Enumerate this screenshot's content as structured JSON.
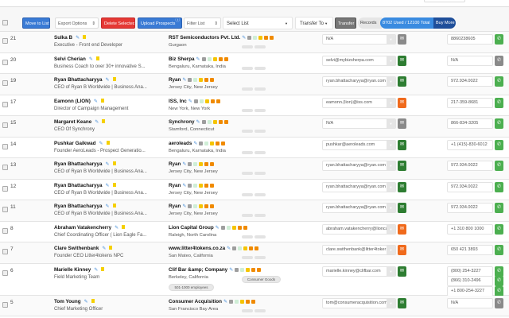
{
  "toolbar": {
    "move_to_list": "Move to List",
    "export_options": "Export Options",
    "delete_selected": "Delete Selected",
    "upload_prospects": "Upload Prospects",
    "filter_list": "Filter List",
    "select_list": "Select List",
    "transfer_to": "Transfer To",
    "transfer": "Transfer",
    "records": "Records",
    "usage": "8702 Used / 12100 Total",
    "buy_more": "Buy More"
  },
  "colors": {
    "green_email": "#2e7d32",
    "orange_email": "#f06a1c",
    "gray": "#8a8a8a",
    "green_phone": "#4caf50",
    "blue": "#3a7bd5",
    "red": "#e53935"
  },
  "rows": [
    {
      "num": "21",
      "name": "Sulka B",
      "title": "Executive - Front end Developer",
      "company": "RST Semiconductors Pvt. Ltd.",
      "location": "Gurgaon",
      "email": "N/A",
      "email_status": "gray",
      "phones": [
        "8860238605"
      ],
      "phone_status": "green"
    },
    {
      "num": "20",
      "name": "Selvi Cherian",
      "title": "Business Coach to over 30+ innovative S...",
      "company": "Biz Sherpa",
      "location": "Bengaluru, Karnataka, India",
      "email": "selvi@mybizsherpa.com",
      "email_status": "green",
      "phones": [
        "N/A"
      ],
      "phone_status": "gray"
    },
    {
      "num": "19",
      "name": "Ryan Bhattacharyya",
      "title": "CEO of Ryan B Worldwide | Business Ana...",
      "company": "Ryan",
      "location": "Jersey City, New Jersey",
      "email": "ryan.bhattacharyya@ryan.com",
      "email_status": "green",
      "phones": [
        "972.934.0022"
      ],
      "phone_status": "green"
    },
    {
      "num": "17",
      "name": "Eamonn (LION)",
      "title": "Director of Campaign Management",
      "company": "ISS, Inc",
      "location": "New York, New York",
      "email": "eamonn.(lion)@iss.com",
      "email_status": "orange",
      "phones": [
        "217-359-8681"
      ],
      "phone_status": "green"
    },
    {
      "num": "15",
      "name": "Margaret Keane",
      "title": "CEO Of Synchrony",
      "company": "Synchrony",
      "location": "Stamford, Connecticut",
      "email": "N/A",
      "email_status": "gray",
      "phones": [
        "866-834-3205"
      ],
      "phone_status": "green"
    },
    {
      "num": "14",
      "name": "Pushkar Gaikwad",
      "title": "Founder AeroLeads - Prospect Generatio...",
      "company": "aeroleads",
      "location": "Bengaluru, Karnataka, India",
      "email": "pushkar@aeroleads.com",
      "email_status": "green",
      "phones": [
        "+1 (415)-830-6012"
      ],
      "phone_status": "green"
    },
    {
      "num": "13",
      "name": "Ryan Bhattacharyya",
      "title": "CEO of Ryan B Worldwide | Business Ana...",
      "company": "Ryan",
      "location": "Jersey City, New Jersey",
      "email": "ryan.bhattacharyya@ryan.com",
      "email_status": "green",
      "phones": [
        "972.934.0022"
      ],
      "phone_status": "green"
    },
    {
      "num": "12",
      "name": "Ryan Bhattacharyya",
      "title": "CEO of Ryan B Worldwide | Business Ana...",
      "company": "Ryan",
      "location": "Jersey City, New Jersey",
      "email": "ryan.bhattacharyya@ryan.com",
      "email_status": "green",
      "phones": [
        "972.934.0022"
      ],
      "phone_status": "green"
    },
    {
      "num": "11",
      "name": "Ryan Bhattacharyya",
      "title": "CEO of Ryan B Worldwide | Business Ana...",
      "company": "Ryan",
      "location": "Jersey City, New Jersey",
      "email": "ryan.bhattacharyya@ryan.com",
      "email_status": "green",
      "phones": [
        "972.934.0022"
      ],
      "phone_status": "green"
    },
    {
      "num": "8",
      "name": "Abraham Vatakencherry",
      "title": "Chief Coordinating Officer ( Lion Eagle Fa...",
      "company": "Lion Capital Group",
      "location": "Raleigh, North Carolina",
      "email": "abraham.vatakencherry@lionca",
      "email_status": "orange",
      "phones": [
        "+1 310 800 1000"
      ],
      "phone_status": "green"
    },
    {
      "num": "7",
      "name": "Clare Swithenbank",
      "title": "Founder CEO Litter4tokens NPC",
      "company": "www.litter4tokens.co.za",
      "location": "San Mateo, California",
      "email": "clare.swithenbank@litter4toker",
      "email_status": "orange",
      "phones": [
        "650 421 3893"
      ],
      "phone_status": "green"
    },
    {
      "num": "6",
      "name": "Marielle Kinney",
      "title": "Field Marketing Team",
      "company": "Clif Bar &amp; Company",
      "location": "Berkeley, California",
      "email": "marielle.kinney@clifbar.com",
      "email_status": "green",
      "phones": [
        "(800) 254-3227",
        "(866) 310-2496",
        "+1 800-254-3227"
      ],
      "phone_status": "green",
      "tags": {
        "industry": "Consumer Goods",
        "size": "501-1000 employees"
      }
    },
    {
      "num": "5",
      "name": "Tom Young",
      "title": "Chief Marketing Officer",
      "company": "Consumer Acquisition",
      "location": "San Francisco Bay Area",
      "email": "tom@consumeracquisition.com",
      "email_status": "green",
      "phones": [
        "N/A"
      ],
      "phone_status": "gray"
    }
  ]
}
